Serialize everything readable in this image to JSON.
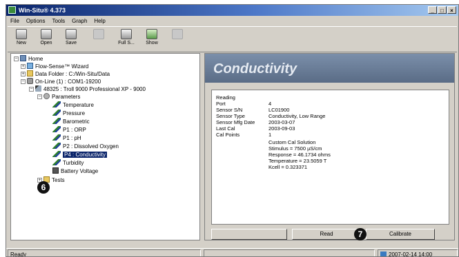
{
  "window": {
    "title": "Win-Situ® 4.373",
    "buttons": [
      "_",
      "□",
      "×"
    ]
  },
  "menu": [
    "File",
    "Options",
    "Tools",
    "Graph",
    "Help"
  ],
  "toolbar": [
    {
      "label": "New",
      "icon": "new-icon",
      "enabled": true
    },
    {
      "label": "Open",
      "icon": "open-icon",
      "enabled": true
    },
    {
      "label": "Save",
      "icon": "save-icon",
      "enabled": true
    },
    {
      "label": "",
      "icon": "connect-icon",
      "enabled": false
    },
    {
      "label": "Full S...",
      "icon": "full-screen-icon",
      "enabled": true
    },
    {
      "label": "Show",
      "icon": "show-icon",
      "enabled": true
    },
    {
      "label": "",
      "icon": "filter-icon",
      "enabled": false
    }
  ],
  "tree": {
    "home": "Home",
    "flow_sensor": "Flow-Sense™ Wizard",
    "data_folder": "Data Folder : C:/Win-Situ/Data",
    "port": "On-Line (1) : COM1-19200",
    "device": "48325 : Troll 9000 Professional XP - 9000",
    "parameters": "Parameters",
    "params": [
      "Temperature",
      "Pressure",
      "Barometric",
      "P1 : ORP",
      "P1 : pH",
      "P2 : Dissolved Oxygen",
      "P4 : Conductivity",
      "Turbidity",
      "Battery Voltage"
    ],
    "selected": "P4 : Conductivity",
    "tests": "Tests"
  },
  "steps": {
    "tree": "6",
    "calibrate": "7"
  },
  "panel": {
    "title": "Conductivity",
    "labels": [
      "Reading",
      "Port",
      "Sensor S/N",
      "Sensor Type",
      "Sensor Mfg Date",
      "Last Cal",
      "Cal Points"
    ],
    "values": [
      "",
      "4",
      "LC01900",
      "Conductivity, Low Range",
      "2003-03-07",
      "2003-09-03",
      "1"
    ],
    "cal_details": [
      "Custom Cal Solution",
      "Stimulus = 7500 µS/cm",
      "Response = 46.1734 ohms",
      "Temperature = 23.5059 T",
      "Kcell = 0.323371"
    ]
  },
  "buttons": {
    "left_disabled": "",
    "read": "Read",
    "calibrate": "Calibrate"
  },
  "status": {
    "text": "Ready",
    "clock": "2007-02-14  14:00"
  }
}
